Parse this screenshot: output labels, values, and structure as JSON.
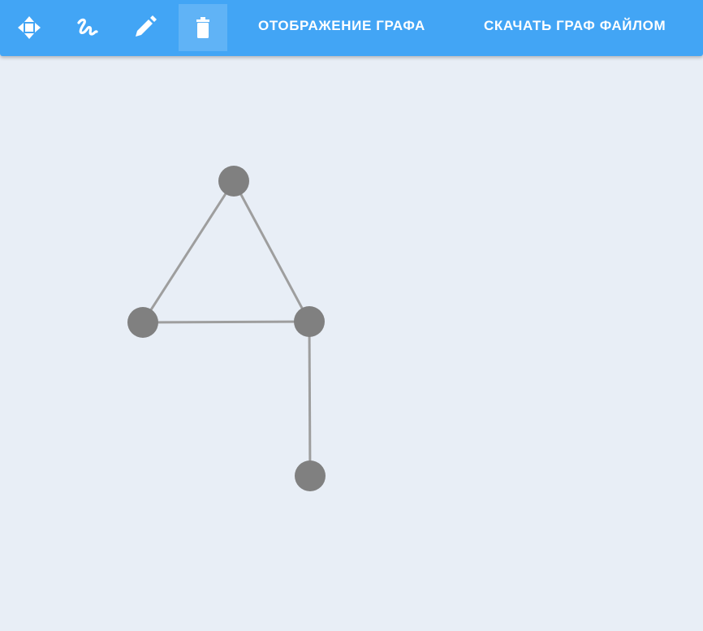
{
  "toolbar": {
    "tools": [
      {
        "name": "move-icon",
        "active": false
      },
      {
        "name": "freehand-icon",
        "active": false
      },
      {
        "name": "pencil-icon",
        "active": false
      },
      {
        "name": "trash-icon",
        "active": true
      }
    ],
    "display_graph_label": "ОТОБРАЖЕНИЕ ГРАФА",
    "download_graph_label": "СКАЧАТЬ ГРАФ ФАЙЛОМ"
  },
  "graph": {
    "node_color": "#808080",
    "edge_color": "#9e9e9e",
    "nodes": [
      {
        "id": "n1"
      },
      {
        "id": "n2"
      },
      {
        "id": "n3"
      },
      {
        "id": "n4"
      }
    ],
    "edges": [
      [
        "n1",
        "n2"
      ],
      [
        "n1",
        "n3"
      ],
      [
        "n2",
        "n3"
      ],
      [
        "n3",
        "n4"
      ]
    ]
  },
  "colors": {
    "toolbar": "#42a5f5",
    "background": "#e8eef6"
  }
}
